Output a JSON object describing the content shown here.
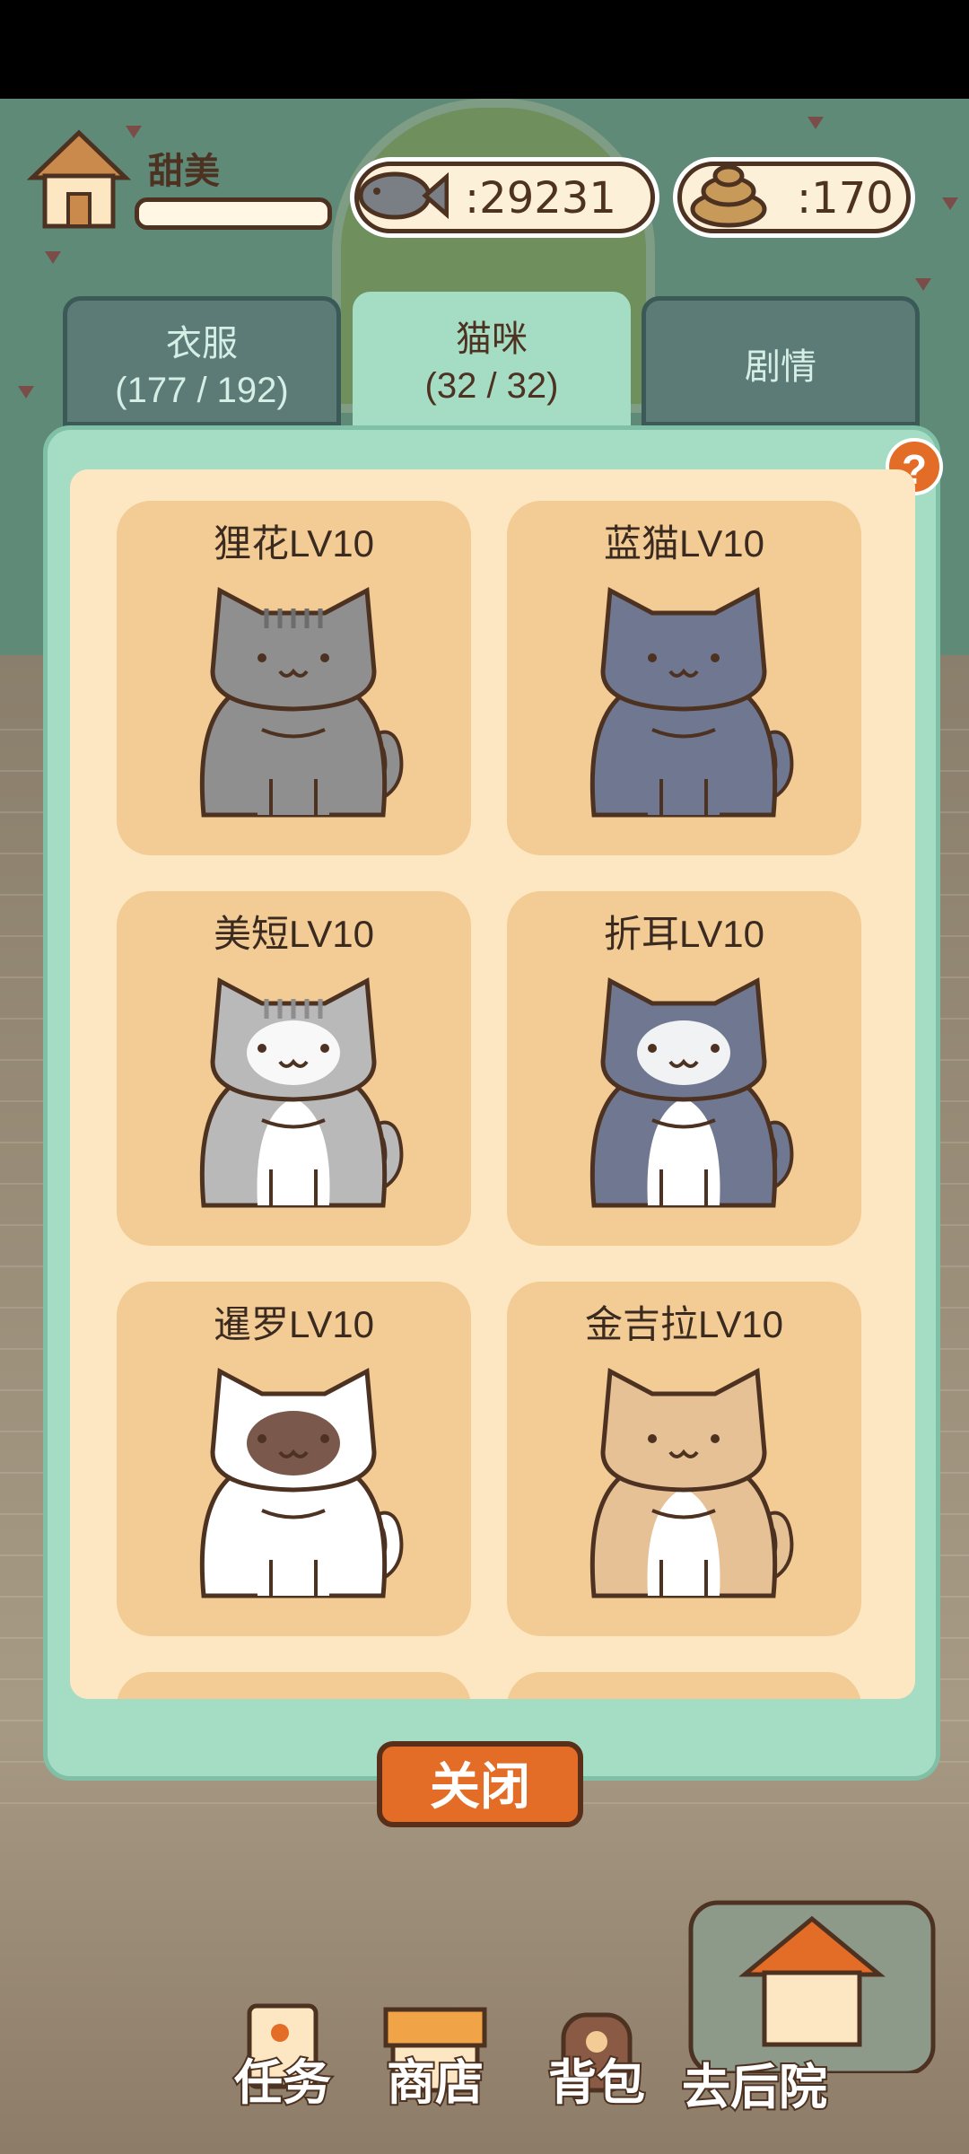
{
  "player": {
    "name": "甜美"
  },
  "currency": {
    "fish_value": ":29231",
    "poop_value": ":170"
  },
  "tabs": [
    {
      "label": "衣服",
      "count": "(177 / 192)",
      "active": false
    },
    {
      "label": "猫咪",
      "count": "(32 / 32)",
      "active": true
    },
    {
      "label": "剧情",
      "count": "",
      "active": false
    }
  ],
  "help_label": "?",
  "cats": [
    {
      "name": "狸花LV10",
      "body": "#8f8f8f",
      "belly": "#8f8f8f",
      "stripes": "#6d6d6d",
      "face": "#8f8f8f"
    },
    {
      "name": "蓝猫LV10",
      "body": "#6f7890",
      "belly": "#6f7890",
      "stripes": "",
      "face": "#6f7890"
    },
    {
      "name": "美短LV10",
      "body": "#b9b9b9",
      "belly": "#ffffff",
      "stripes": "#8d8d8d",
      "face": "#ffffff"
    },
    {
      "name": "折耳LV10",
      "body": "#6f7890",
      "belly": "#ffffff",
      "stripes": "",
      "face": "#ffffff"
    },
    {
      "name": "暹罗LV10",
      "body": "#ffffff",
      "belly": "#ffffff",
      "stripes": "",
      "face": "#6b4638"
    },
    {
      "name": "金吉拉LV10",
      "body": "#e6c196",
      "belly": "#ffffff",
      "stripes": "",
      "face": "#e6c196"
    }
  ],
  "close_label": "关闭",
  "nav": {
    "tasks": "任务",
    "shop": "商店",
    "backpack": "背包",
    "backyard": "去后院"
  },
  "colors": {
    "accent": "#e36c27",
    "panel": "#a5dcc4",
    "card": "#f2cc94",
    "outline": "#4d3222"
  }
}
